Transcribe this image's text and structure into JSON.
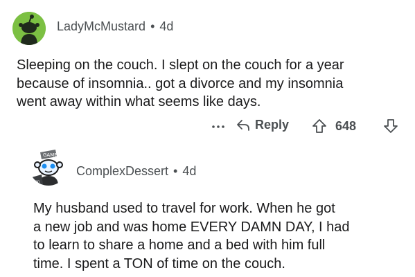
{
  "comments": [
    {
      "username": "LadyMcMustard",
      "separator": "•",
      "age": "4d",
      "avatar_icon": "snoo-avatar-icon",
      "avatar_bg": "#7cc043",
      "body_lines": [
        "Sleeping on the couch. I slept on the couch for a year",
        "because of insomnia.. got a divorce and my insomnia",
        "went away within what seems like days."
      ],
      "actions": {
        "more_icon": "ellipsis-icon",
        "reply_icon": "reply-arrow-icon",
        "reply_label": "Reply",
        "upvote_icon": "upvote-arrow-icon",
        "score": "648",
        "downvote_icon": "downvote-arrow-icon"
      }
    },
    {
      "username": "ComplexDessert",
      "separator": "•",
      "age": "4d",
      "avatar_icon": "snoo-costume-avatar-icon",
      "body_lines": [
        "My husband used to travel for work.  When he got",
        "a new job and was home EVERY DAMN DAY, I had",
        "to learn to share a home and a bed with him full",
        "time.  I spent a TON of time on the couch."
      ]
    }
  ],
  "colors": {
    "text": "#1a1a1b",
    "meta": "#4b4f52",
    "avatar_green": "#7cc043"
  }
}
